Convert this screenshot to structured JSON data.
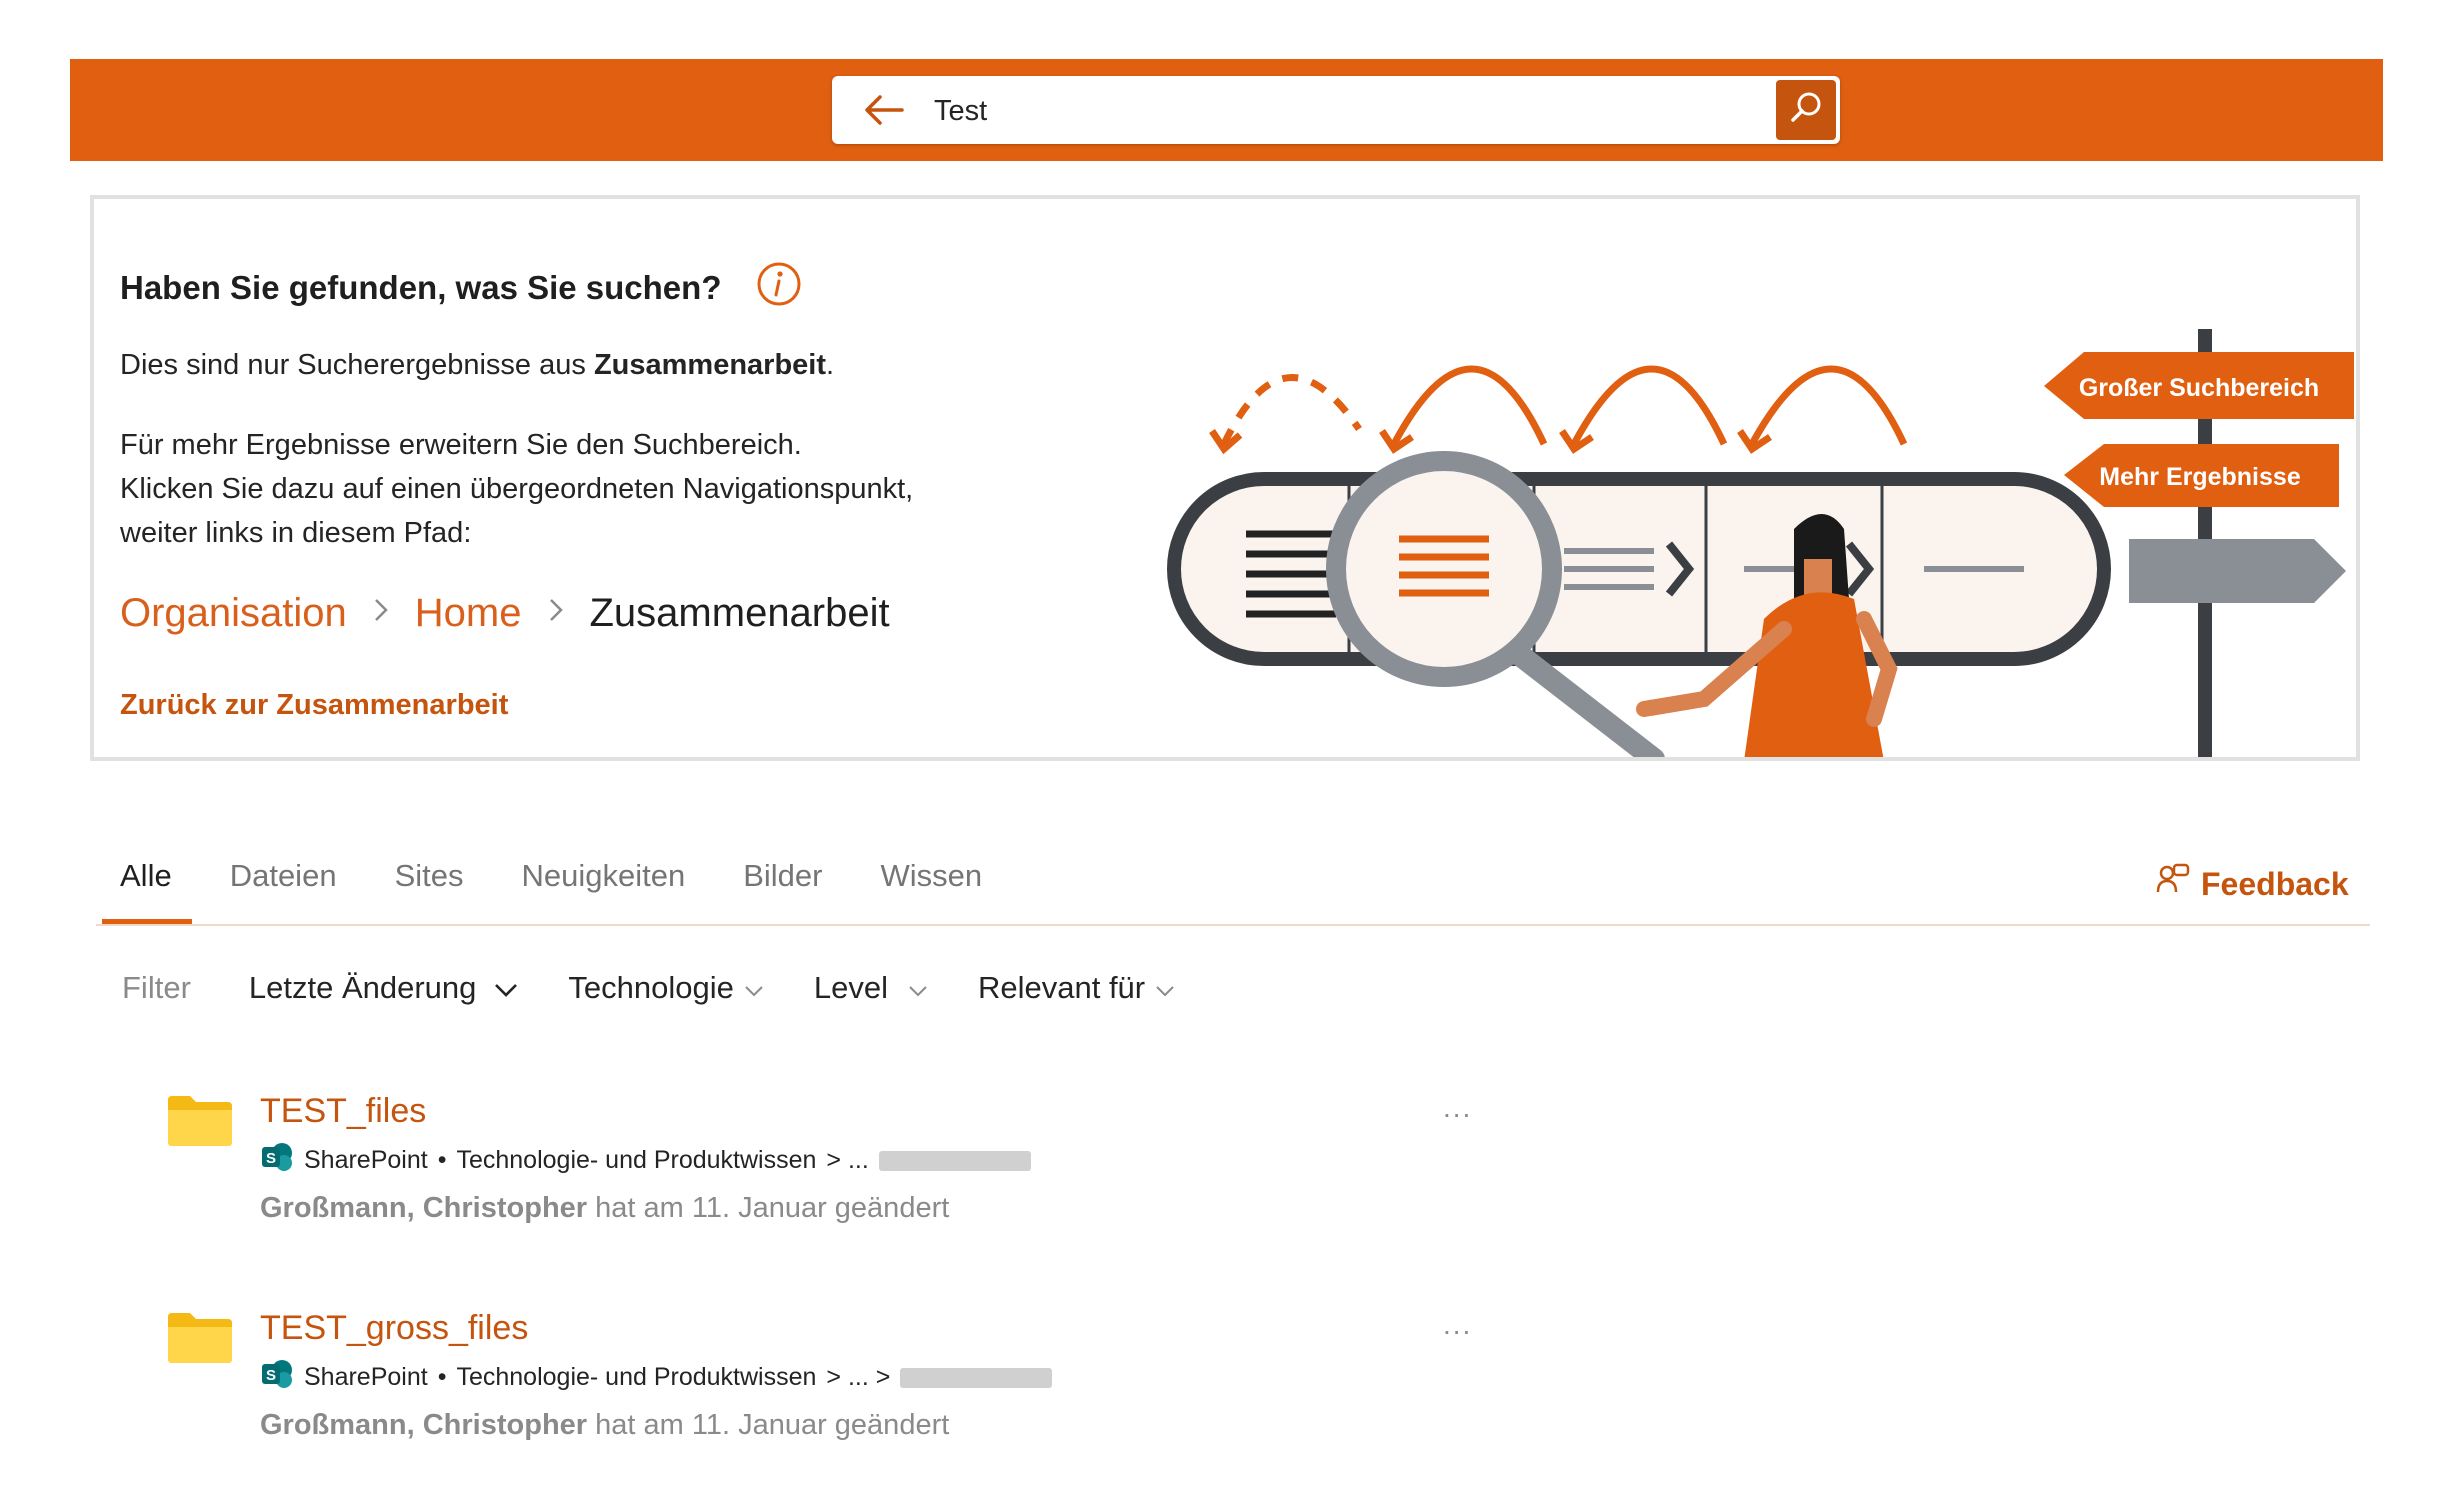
{
  "search": {
    "value": "Test"
  },
  "panel": {
    "title": "Haben Sie gefunden, was Sie suchen?",
    "line1_prefix": "Dies sind nur Sucherergebnisse aus ",
    "line1_bold": "Zusammenarbeit",
    "line1_suffix": ".",
    "para_line1": "Für mehr Ergebnisse erweitern Sie den Suchbereich.",
    "para_line2": "Klicken Sie dazu auf einen übergeordneten Navigationspunkt,",
    "para_line3": "weiter links in diesem Pfad:",
    "breadcrumb": [
      "Organisation",
      "Home",
      "Zusammenarbeit"
    ],
    "back_link": "Zurück zur Zusammenarbeit",
    "sign_big": "Großer Suchbereich",
    "sign_more": "Mehr Ergebnisse"
  },
  "tabs": [
    "Alle",
    "Dateien",
    "Sites",
    "Neuigkeiten",
    "Bilder",
    "Wissen"
  ],
  "active_tab": "Alle",
  "feedback_label": "Feedback",
  "filters": {
    "label": "Filter",
    "dropdowns": [
      "Letzte Änderung",
      "Technologie",
      "Level",
      "Relevant für"
    ]
  },
  "results": [
    {
      "title": "TEST_files",
      "source": "SharePoint",
      "bullet": "•",
      "site": "Technologie- und Produktwissen",
      "path_tail": "> ...",
      "author": "Großmann, Christopher",
      "change_text": "hat am 11. Januar geändert",
      "more": "..."
    },
    {
      "title": "TEST_gross_files",
      "source": "SharePoint",
      "bullet": "•",
      "site": "Technologie- und Produktwissen",
      "path_tail": "> ... >",
      "author": "Großmann, Christopher",
      "change_text": "hat am 11. Januar geändert",
      "more": "..."
    }
  ],
  "colors": {
    "brand_orange": "#e05f10",
    "link_orange": "#c4540e",
    "grey_text": "#8a8a8a"
  },
  "icons": [
    "back-arrow-icon",
    "search-icon",
    "info-icon",
    "feedback-icon",
    "chevron-down-icon",
    "folder-icon",
    "sharepoint-icon"
  ]
}
